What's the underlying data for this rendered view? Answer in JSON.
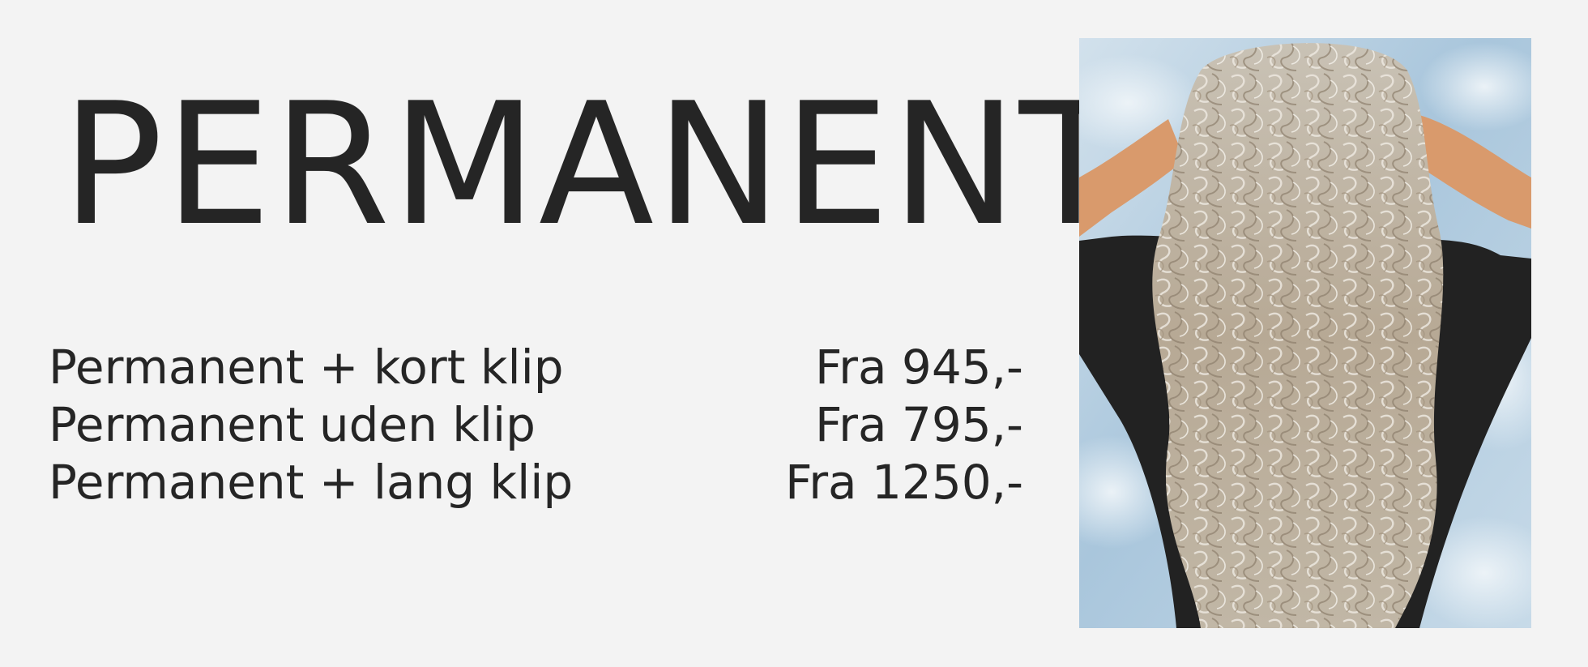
{
  "page": {
    "title": "PERMANENT"
  },
  "prices": [
    {
      "service": "Permanent + kort klip",
      "price": "Fra 945,-"
    },
    {
      "service": "Permanent uden klip",
      "price": "Fra 795,-"
    },
    {
      "service": "Permanent + lang klip",
      "price": "Fra 1250,-"
    }
  ],
  "colors": {
    "background": "#f3f3f3",
    "text": "#252525",
    "sky": "#a9c6dc",
    "hair": "#b8ab98",
    "skin": "#d99a6c",
    "shirt": "#222222"
  },
  "image": {
    "subject": "illustration-woman-curly-hair-back-view"
  }
}
